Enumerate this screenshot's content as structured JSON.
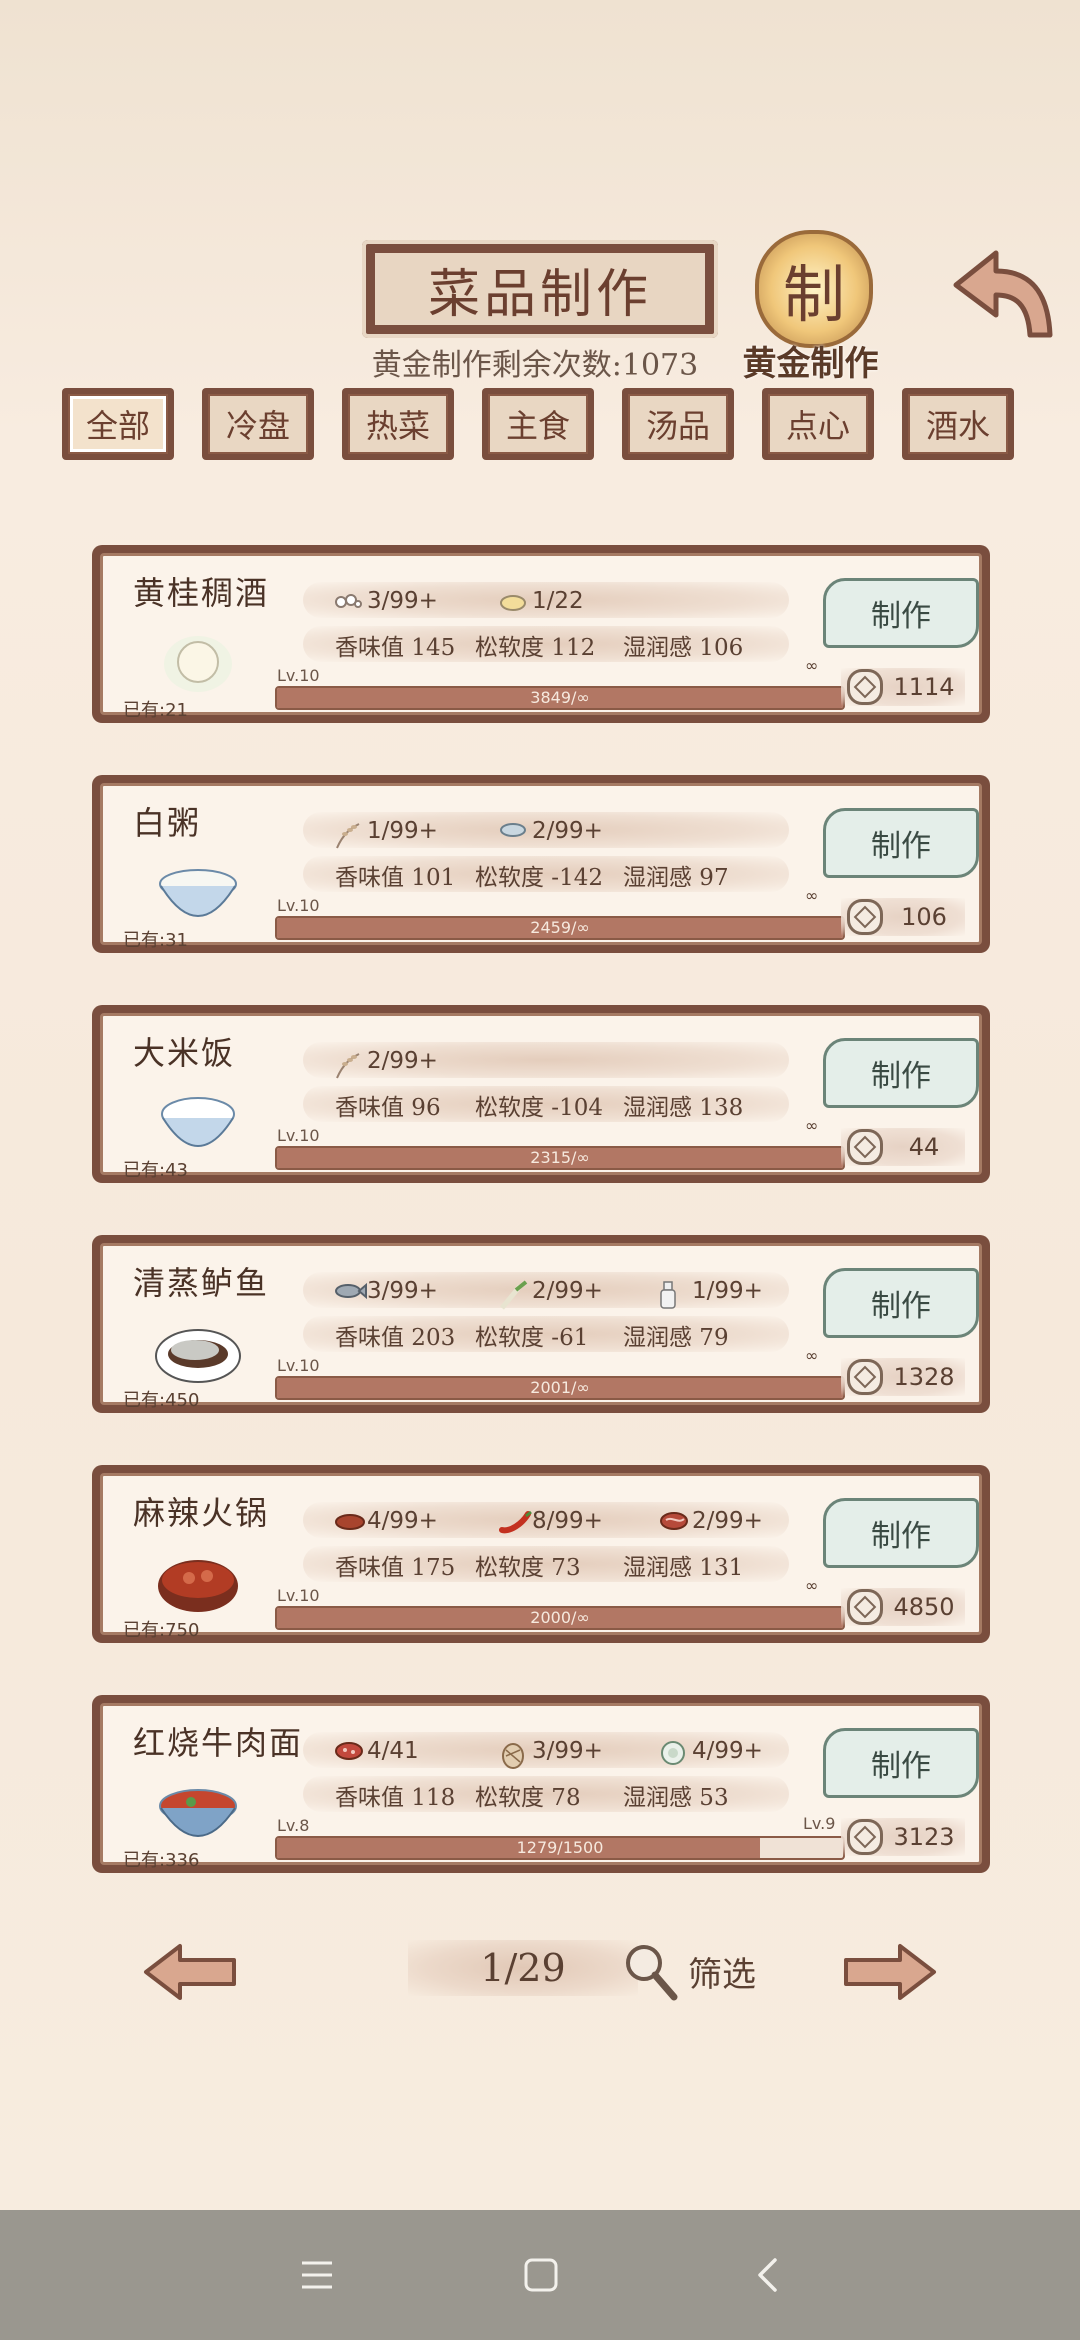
{
  "header": {
    "title": "菜品制作",
    "gold_count_text": "黄金制作剩余次数:1073",
    "gold_stamp_char": "制",
    "gold_label": "黄金制作"
  },
  "tabs": [
    {
      "label": "全部",
      "active": true
    },
    {
      "label": "冷盘",
      "active": false
    },
    {
      "label": "热菜",
      "active": false
    },
    {
      "label": "主食",
      "active": false
    },
    {
      "label": "汤品",
      "active": false
    },
    {
      "label": "点心",
      "active": false
    },
    {
      "label": "酒水",
      "active": false
    }
  ],
  "recipes": [
    {
      "name": "黄桂稠酒",
      "owned": "已有:21",
      "level_left": "Lv.10",
      "level_right": "∞",
      "ingredients": [
        {
          "icon": "rice-wine-ingredient-icon",
          "count": "3/99+"
        },
        {
          "icon": "osmanthus-ingredient-icon",
          "count": "1/22"
        }
      ],
      "stats": {
        "aroma": "香味值 145",
        "softness": "松软度 112",
        "moisture": "湿润感 106"
      },
      "progress_text": "3849/∞",
      "progress": 1.0,
      "make_label": "制作",
      "price": "1114"
    },
    {
      "name": "白粥",
      "owned": "已有:31",
      "level_left": "Lv.10",
      "level_right": "∞",
      "ingredients": [
        {
          "icon": "rice-stalk-icon",
          "count": "1/99+"
        },
        {
          "icon": "water-bowl-icon",
          "count": "2/99+"
        }
      ],
      "stats": {
        "aroma": "香味值 101",
        "softness": "松软度 -142",
        "moisture": "湿润感 97"
      },
      "progress_text": "2459/∞",
      "progress": 1.0,
      "make_label": "制作",
      "price": "106"
    },
    {
      "name": "大米饭",
      "owned": "已有:43",
      "level_left": "Lv.10",
      "level_right": "∞",
      "ingredients": [
        {
          "icon": "rice-stalk-icon",
          "count": "2/99+"
        }
      ],
      "stats": {
        "aroma": "香味值 96",
        "softness": "松软度 -104",
        "moisture": "湿润感 138"
      },
      "progress_text": "2315/∞",
      "progress": 1.0,
      "make_label": "制作",
      "price": "44"
    },
    {
      "name": "清蒸鲈鱼",
      "owned": "已有:450",
      "level_left": "Lv.10",
      "level_right": "∞",
      "ingredients": [
        {
          "icon": "fish-icon",
          "count": "3/99+"
        },
        {
          "icon": "scallion-icon",
          "count": "2/99+"
        },
        {
          "icon": "bottle-icon",
          "count": "1/99+"
        }
      ],
      "stats": {
        "aroma": "香味值 203",
        "softness": "松软度 -61",
        "moisture": "湿润感 79"
      },
      "progress_text": "2001/∞",
      "progress": 1.0,
      "make_label": "制作",
      "price": "1328"
    },
    {
      "name": "麻辣火锅",
      "owned": "已有:750",
      "level_left": "Lv.10",
      "level_right": "∞",
      "ingredients": [
        {
          "icon": "sauce-plate-icon",
          "count": "4/99+"
        },
        {
          "icon": "chili-icon",
          "count": "8/99+"
        },
        {
          "icon": "meat-icon",
          "count": "2/99+"
        }
      ],
      "stats": {
        "aroma": "香味值 175",
        "softness": "松软度 73",
        "moisture": "湿润感 131"
      },
      "progress_text": "2000/∞",
      "progress": 1.0,
      "make_label": "制作",
      "price": "4850"
    },
    {
      "name": "红烧牛肉面",
      "owned": "已有:336",
      "level_left": "Lv.8",
      "level_right": "Lv.9",
      "ingredients": [
        {
          "icon": "beef-icon",
          "count": "4/41"
        },
        {
          "icon": "dough-icon",
          "count": "3/99+"
        },
        {
          "icon": "broth-bowl-icon",
          "count": "4/99+"
        }
      ],
      "stats": {
        "aroma": "香味值 118",
        "softness": "松软度 78",
        "moisture": "湿润感 53"
      },
      "progress_text": "1279/1500",
      "progress": 0.853,
      "make_label": "制作",
      "price": "3123"
    }
  ],
  "pager": {
    "page_text": "1/29",
    "filter_label": "筛选"
  },
  "colors": {
    "frame": "#7a4e3e",
    "parchment": "#fbf3ea",
    "make_button": "#e4eee9",
    "progress_fill": "#b27764"
  }
}
